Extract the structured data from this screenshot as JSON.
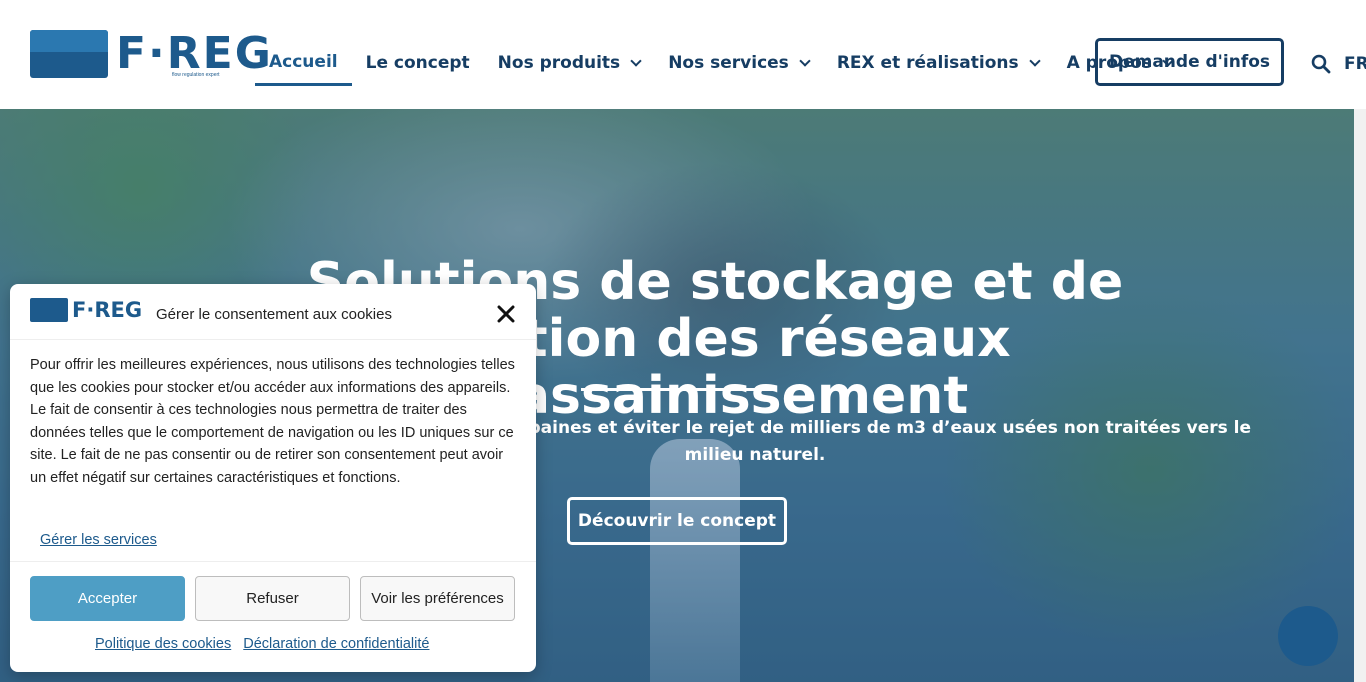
{
  "header": {
    "logo_text": "F·REG",
    "logo_tagline": "flow regulation expert",
    "nav": [
      {
        "label": "Accueil"
      },
      {
        "label": "Le concept"
      },
      {
        "label": "Nos produits"
      },
      {
        "label": "Nos services"
      },
      {
        "label": "REX et réalisations"
      },
      {
        "label": "A propos"
      }
    ],
    "cta_label": "Demande d'infos",
    "lang": "FR"
  },
  "hero": {
    "title": "Solutions de stockage et de gestion des réseaux d'assainissement",
    "subtitle": "Protéger des inondations urbaines et éviter le rejet de milliers de m3 d’eaux usées non traitées vers le milieu naturel.",
    "button_label": "Découvrir le concept"
  },
  "cookie": {
    "logo_text": "F·REG",
    "title": "Gérer le consentement aux cookies",
    "body": "Pour offrir les meilleures expériences, nous utilisons des technologies telles que les cookies pour stocker et/ou accéder aux informations des appareils. Le fait de consentir à ces technologies nous permettra de traiter des données telles que le comportement de navigation ou les ID uniques sur ce site. Le fait de ne pas consentir ou de retirer son consentement peut avoir un effet négatif sur certaines caractéristiques et fonctions.",
    "manage_services": "Gérer les services",
    "accept": "Accepter",
    "refuse": "Refuser",
    "preferences": "Voir les préférences",
    "cookie_policy": "Politique des cookies",
    "privacy": "Déclaration de confidentialité"
  },
  "colors": {
    "brand": "#1d5a8c",
    "nav_text": "#163d63",
    "accept_button": "#4e9ec5"
  },
  "icons": [
    "search-icon",
    "chevron-down-icon",
    "close-icon",
    "chat-icon"
  ]
}
